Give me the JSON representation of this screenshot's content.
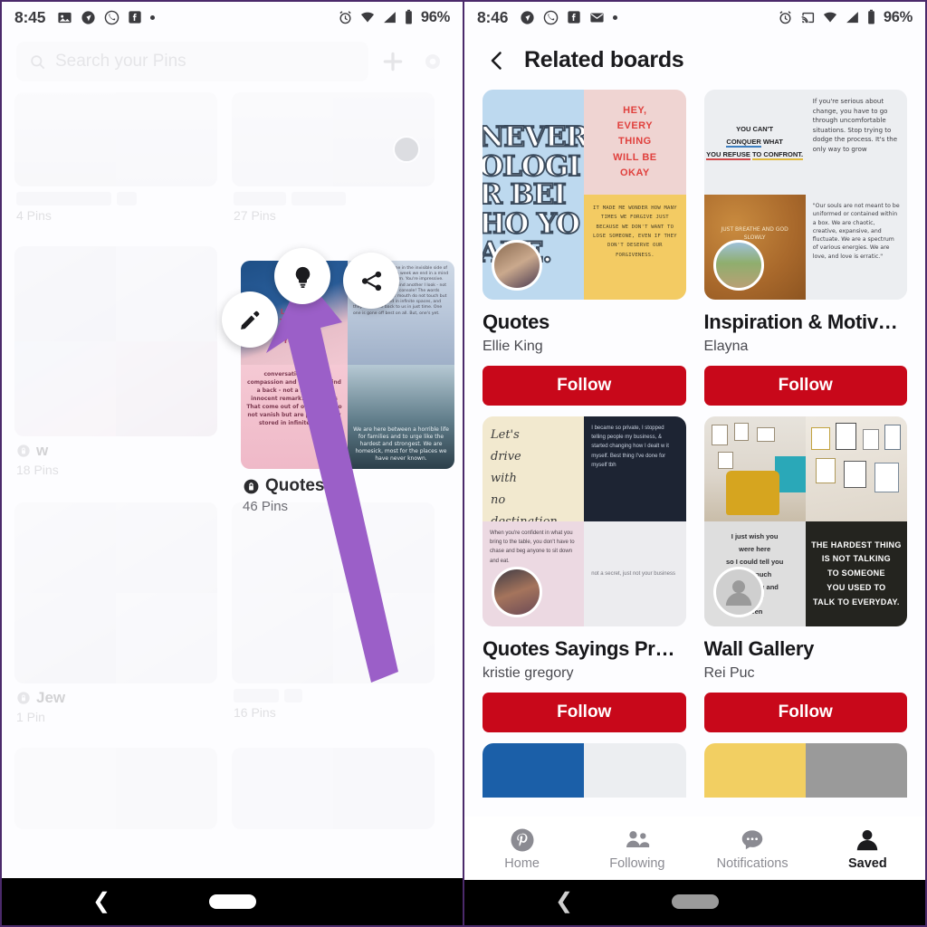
{
  "left": {
    "status": {
      "time": "8:45",
      "battery": "96%",
      "left_icons": [
        "photo-icon",
        "navigation-icon",
        "whatsapp-icon",
        "facebook-icon",
        "dot-icon"
      ],
      "right_icons": [
        "alarm-icon",
        "wifi-icon",
        "signal-icon",
        "battery-icon"
      ]
    },
    "search": {
      "placeholder": "Search your Pins",
      "add_icon": "plus-icon",
      "settings_icon": "gear-icon"
    },
    "boards": [
      {
        "name": "",
        "pins": "4 Pins",
        "blurred": true
      },
      {
        "name": "",
        "pins": "27 Pins",
        "blurred": true
      },
      {
        "name": "w",
        "pins": "18 Pins",
        "blurred": true,
        "secret": true
      },
      {
        "name": "Quotes",
        "pins": "46 Pins",
        "blurred": false,
        "secret": true
      },
      {
        "name": "Jew",
        "pins": "1 Pin",
        "blurred": true,
        "secret": true
      },
      {
        "name": "",
        "pins": "16 Pins",
        "blurred": true
      }
    ],
    "actions": [
      {
        "id": "edit-board",
        "icon": "pencil-icon"
      },
      {
        "id": "board-ideas",
        "icon": "lightbulb-icon"
      },
      {
        "id": "share-board",
        "icon": "share-icon"
      }
    ],
    "annotation": {
      "shape": "arrow",
      "color": "#9b5fc8",
      "points_to": "board-action-buttons"
    },
    "android": {
      "back": "back-chevron-icon",
      "home": "home-pill"
    }
  },
  "right": {
    "status": {
      "time": "8:46",
      "battery": "96%",
      "left_icons": [
        "navigation-icon",
        "whatsapp-icon",
        "facebook-icon",
        "mail-icon",
        "dot-icon"
      ],
      "right_icons": [
        "alarm-icon",
        "cast-icon",
        "wifi-icon",
        "signal-icon",
        "battery-icon"
      ]
    },
    "header": {
      "back_icon": "back-chevron-icon",
      "title": "Related boards"
    },
    "follow_color": "#c8081a",
    "cards": [
      {
        "name": "Quotes",
        "user": "Ellie King",
        "follow_label": "Follow",
        "avatar": "photo-avatar",
        "tiles": {
          "big": "NEVER\nOLOGI\nR BEI\nHO YO\nARE.",
          "pink": "HEY,\nEVERY\nTHING\nWILL BE\nOKAY",
          "yellow": "IT MADE ME WONDER HOW MANY TIMES WE FORGIVE JUST BECAUSE WE DON'T WANT TO LOSE SOMEONE, EVEN IF THEY DON'T DESERVE OUR FORGIVENESS."
        }
      },
      {
        "name": "Inspiration & Motiv…",
        "user": "Elayna",
        "follow_label": "Follow",
        "avatar": "landscape-avatar",
        "tiles": {
          "hand": "YOU CAN'T\nCONQUER WHAT\nYOU REFUSE TO CONFRONT.",
          "text1": "If you're serious about change, you have to go through uncomfortable situations. Stop trying to dodge the process. It's the only way to grow",
          "text2": "\"Our souls are not meant to be uniformed or contained within a box. We are chaotic, creative, expansive, and fluctuate. We are a spectrum of various energies. We are love, and love is erratic.\"",
          "floral": "floral-quote-image"
        }
      },
      {
        "name": "Quotes Sayings Pr…",
        "user": "kristie gregory",
        "follow_label": "Follow",
        "avatar": "woman-avatar",
        "tiles": {
          "script": "Let's\ndrive\nwith\nno destination.",
          "dark": "I became so private, I stopped telling people my business, & started changing how I dealt w it myself. Best thing I've done for myself tbh",
          "pink": "When you're confident in what you bring to the table, you don't have to chase and beg anyone to sit down and eat.",
          "gray": "not a secret, just not your business"
        }
      },
      {
        "name": "Wall Gallery",
        "user": "Rei Puc",
        "follow_label": "Follow",
        "avatar": "default-avatar",
        "tiles": {
          "room": "yellow-chair-room-image",
          "frames": "gallery-wall-image",
          "memo": "I just wish you\nwere here\nso I could tell you\nhow much\nI need you and\nevery\nbeen",
          "black": "THE HARDEST THING\nIS NOT TALKING\nTO SOMEONE\nYOU USED TO\nTALK TO EVERYDAY."
        }
      }
    ],
    "bottom_nav": [
      {
        "label": "Home",
        "icon": "pinterest-icon",
        "active": false
      },
      {
        "label": "Following",
        "icon": "people-icon",
        "active": false
      },
      {
        "label": "Notifications",
        "icon": "chat-bubble-icon",
        "active": false
      },
      {
        "label": "Saved",
        "icon": "person-icon",
        "active": true
      }
    ],
    "android": {
      "back": "back-chevron-icon",
      "home": "home-pill"
    }
  }
}
